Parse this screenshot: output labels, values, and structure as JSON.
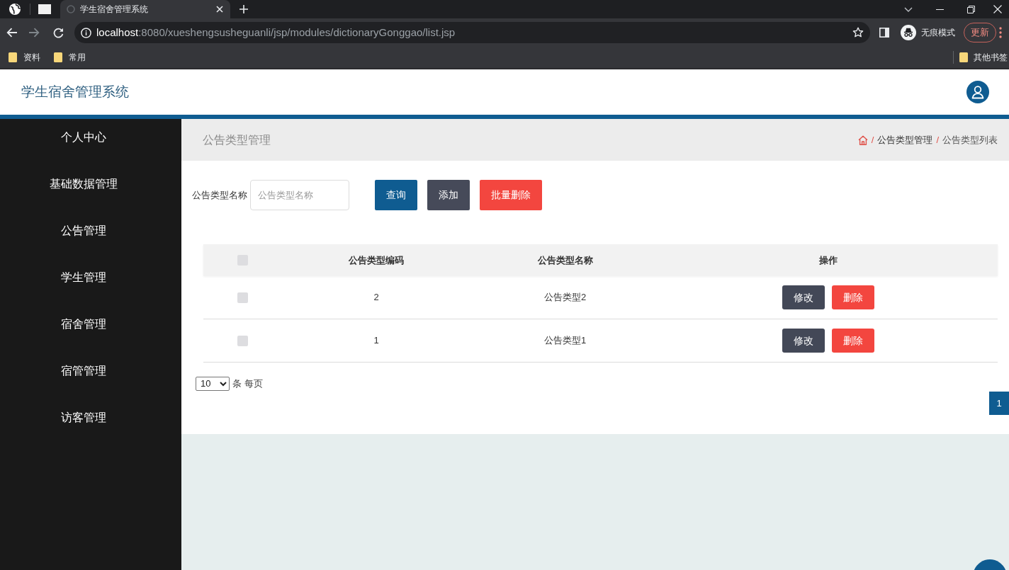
{
  "browser": {
    "tabs": [
      {
        "title": "学生宿舍管理系统",
        "selected": true
      }
    ],
    "forward_button": {
      "disabled": true
    },
    "url": {
      "host": "localhost",
      "path": ":8080/xueshengsusheguanli/jsp/modules/dictionaryGonggao/list.jsp"
    },
    "profile_label": "无痕模式",
    "update_button": "更新",
    "bookmarks": [
      {
        "label": "资料"
      },
      {
        "label": "常用"
      }
    ],
    "other_bookmarks": "其他书签"
  },
  "app": {
    "title": "学生宿舍管理系统"
  },
  "sidebar": {
    "items": [
      {
        "label": "个人中心"
      },
      {
        "label": "基础数据管理"
      },
      {
        "label": "公告管理"
      },
      {
        "label": "学生管理"
      },
      {
        "label": "宿舍管理"
      },
      {
        "label": "宿管管理"
      },
      {
        "label": "访客管理"
      }
    ]
  },
  "page": {
    "title": "公告类型管理",
    "breadcrumb": [
      {
        "kind": "home"
      },
      {
        "kind": "separator",
        "text": "/"
      },
      {
        "kind": "link",
        "text": "公告类型管理"
      },
      {
        "kind": "separator",
        "text": "/"
      },
      {
        "kind": "current",
        "text": "公告类型列表"
      }
    ]
  },
  "search": {
    "label": "公告类型名称",
    "placeholder": "公告类型名称",
    "buttons": [
      {
        "label": "查询",
        "kind": "primary"
      },
      {
        "label": "添加",
        "kind": "secondary"
      },
      {
        "label": "批量删除",
        "kind": "danger"
      }
    ]
  },
  "table": {
    "select_all": {
      "checked": false
    },
    "columns": [
      "公告类型编码",
      "公告类型名称",
      "操作"
    ],
    "rows": [
      {
        "checked": false,
        "cells": [
          "2",
          "公告类型2"
        ],
        "actions": [
          {
            "label": "修改",
            "kind": "edit"
          },
          {
            "label": "删除",
            "kind": "delete"
          }
        ]
      },
      {
        "checked": false,
        "cells": [
          "1",
          "公告类型1"
        ],
        "actions": [
          {
            "label": "修改",
            "kind": "edit"
          },
          {
            "label": "删除",
            "kind": "delete"
          }
        ]
      }
    ]
  },
  "pagination": {
    "page_size": "10",
    "page_size_label": "条 每页",
    "pages": [
      {
        "label": "1",
        "selected": true
      }
    ]
  }
}
